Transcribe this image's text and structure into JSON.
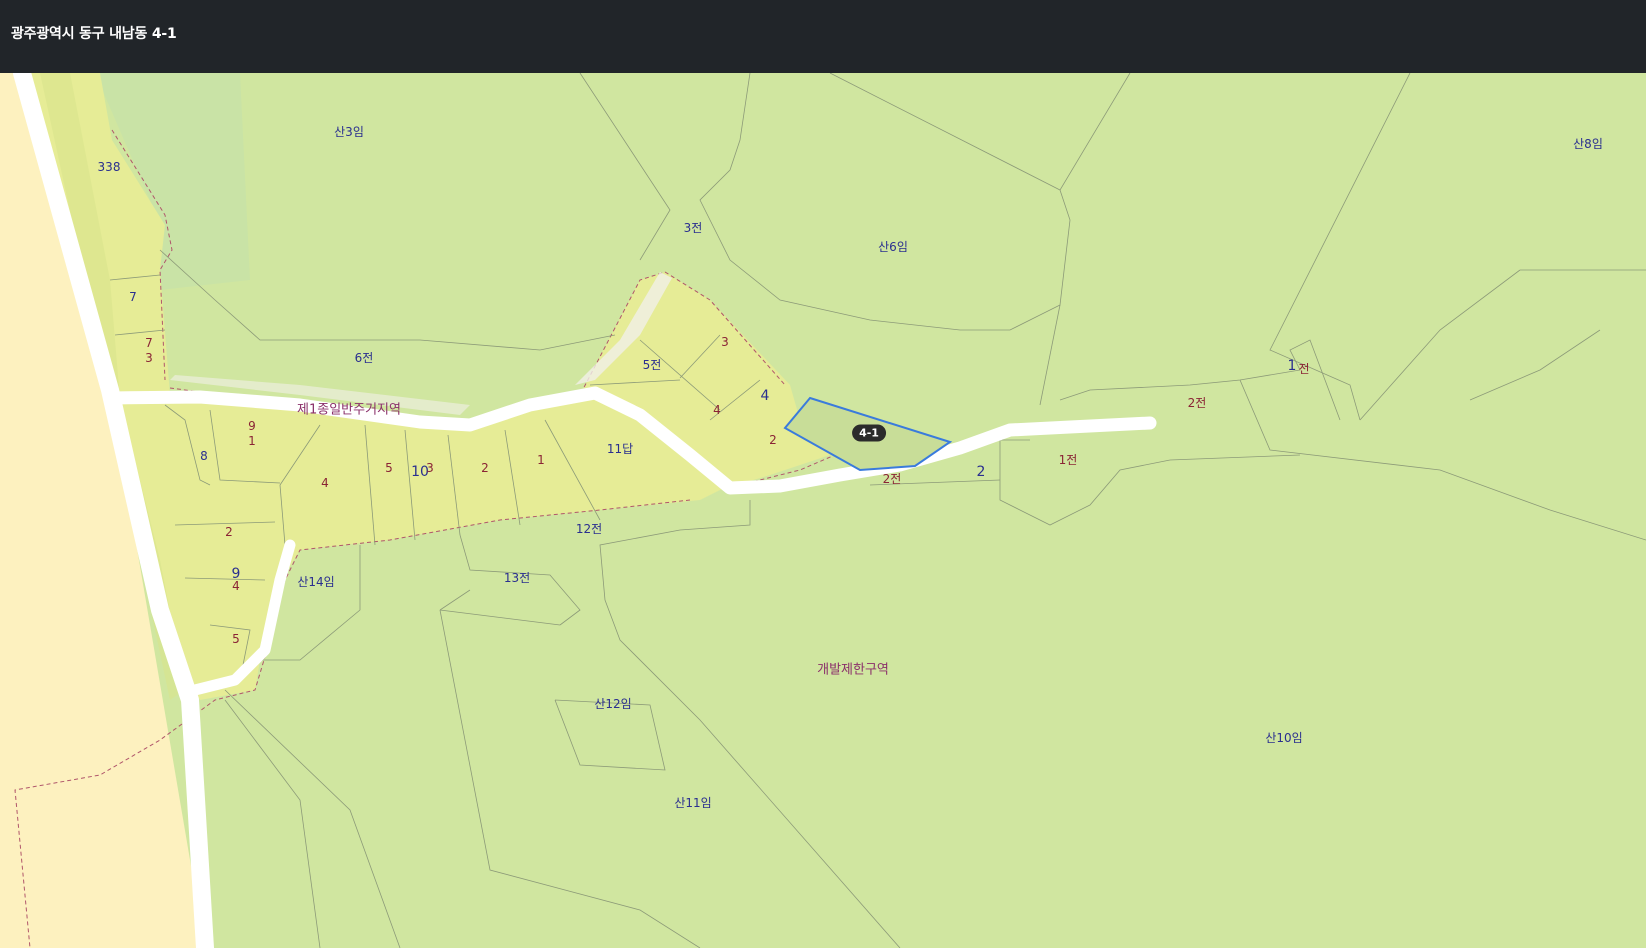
{
  "header": {
    "address": "광주광역시 동구 내남동 4-1"
  },
  "map": {
    "colors": {
      "forest": "#d0e6a0",
      "residential": "#e6ec96",
      "urban": "#fdf1bf",
      "road": "#ffffff",
      "selected_outline": "#3a7bdc",
      "zone_text": "#8a2f6a"
    },
    "selected_parcel": "4-1",
    "labels": {
      "san3": "산3임",
      "san8": "산8임",
      "n338": "338",
      "jeon3": "3전",
      "san6": "산6임",
      "n7": "7",
      "n73a": "7",
      "n73b": "3",
      "im6": "6전",
      "n3": "3",
      "jeon5": "5전",
      "n4a": "4",
      "n1jeon_one": "1",
      "n1jeon_txt": "전",
      "jeon2_right": "2전",
      "zone_res": "제1종일반주거지역",
      "n91a": "9",
      "n91b": "1",
      "n8": "8",
      "n4b": "4",
      "n2a": "2",
      "dap11": "11답",
      "n4c": "4",
      "n5": "5",
      "n10": "10",
      "n3b": "3",
      "n2b": "2",
      "n1": "1",
      "jeon2_mid": "2전",
      "n2big": "2",
      "jeon1": "1전",
      "n2c": "2",
      "jeon12": "12전",
      "n94a": "9",
      "n94b": "4",
      "san14": "산14임",
      "jeon13": "13전",
      "n5b": "5",
      "zone_dev": "개발제한구역",
      "san12": "산12임",
      "san10": "산10임",
      "san11": "산11임"
    }
  }
}
